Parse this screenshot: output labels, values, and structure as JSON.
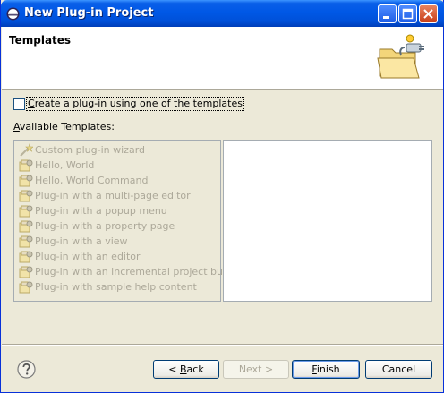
{
  "window": {
    "title": "New Plug-in Project",
    "controls": {
      "minimize": "minimize-icon",
      "maximize": "maximize-icon",
      "close": "close-icon"
    },
    "title_icon": "eclipse-icon"
  },
  "banner": {
    "title": "Templates",
    "icon": "plugin-folder-icon"
  },
  "checkbox": {
    "checked": false,
    "label_mnemonic": "C",
    "label_rest": "reate a plug-in using one of the templates"
  },
  "available": {
    "mnemonic": "A",
    "rest": "vailable Templates:"
  },
  "templates": [
    {
      "label": "Custom plug-in wizard",
      "icon": "wizard-wand-icon"
    },
    {
      "label": "Hello, World",
      "icon": "plugin-template-icon"
    },
    {
      "label": "Hello, World Command",
      "icon": "plugin-template-icon"
    },
    {
      "label": "Plug-in with a multi-page editor",
      "icon": "plugin-template-icon"
    },
    {
      "label": "Plug-in with a popup menu",
      "icon": "plugin-template-icon"
    },
    {
      "label": "Plug-in with a property page",
      "icon": "plugin-template-icon"
    },
    {
      "label": "Plug-in with a view",
      "icon": "plugin-template-icon"
    },
    {
      "label": "Plug-in with an editor",
      "icon": "plugin-template-icon"
    },
    {
      "label": "Plug-in with an incremental project builder",
      "icon": "plugin-template-icon"
    },
    {
      "label": "Plug-in with sample help content",
      "icon": "plugin-template-icon"
    }
  ],
  "buttons": {
    "back_prefix": "< ",
    "back_mnemonic": "B",
    "back_rest": "ack",
    "next_label": "Next >",
    "finish_mnemonic": "F",
    "finish_rest": "inish",
    "cancel_label": "Cancel"
  },
  "help_icon": "help-icon",
  "colors": {
    "titlebar": "#0058E6",
    "dialog_bg": "#ECE9D8",
    "disabled_text": "#ACA899"
  }
}
